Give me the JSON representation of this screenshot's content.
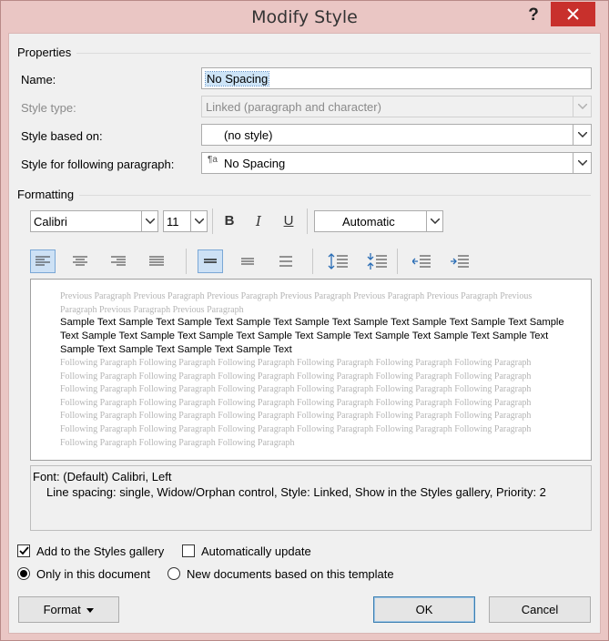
{
  "window": {
    "title": "Modify Style",
    "help_glyph": "?"
  },
  "properties": {
    "section_label": "Properties",
    "name_label": "Name:",
    "name_value": "No Spacing",
    "style_type_label": "Style type:",
    "style_type_value": "Linked (paragraph and character)",
    "based_on_label": "Style based on:",
    "based_on_value": "(no style)",
    "following_label": "Style for following paragraph:",
    "following_value": "No Spacing",
    "following_icon": "paragraph-style-icon"
  },
  "formatting": {
    "section_label": "Formatting",
    "font": "Calibri",
    "size": "11",
    "bold_glyph": "B",
    "italic_glyph": "I",
    "underline_glyph": "U",
    "color": "Automatic"
  },
  "preview": {
    "previous": "Previous Paragraph Previous Paragraph Previous Paragraph Previous Paragraph Previous Paragraph Previous Paragraph Previous Paragraph Previous Paragraph Previous Paragraph",
    "sample": "Sample Text Sample Text Sample Text Sample Text Sample Text Sample Text Sample Text Sample Text Sample Text Sample Text Sample Text Sample Text Sample Text Sample Text Sample Text Sample Text Sample Text Sample Text Sample Text Sample Text Sample Text",
    "following": "Following Paragraph Following Paragraph Following Paragraph Following Paragraph Following Paragraph Following Paragraph Following Paragraph Following Paragraph Following Paragraph Following Paragraph Following Paragraph Following Paragraph Following Paragraph Following Paragraph Following Paragraph Following Paragraph Following Paragraph Following Paragraph Following Paragraph Following Paragraph Following Paragraph Following Paragraph Following Paragraph Following Paragraph Following Paragraph Following Paragraph Following Paragraph Following Paragraph Following Paragraph Following Paragraph Following Paragraph Following Paragraph Following Paragraph Following Paragraph Following Paragraph Following Paragraph Following Paragraph Following Paragraph Following Paragraph"
  },
  "description": {
    "line1": "Font: (Default) Calibri, Left",
    "line2": "Line spacing:  single, Widow/Orphan control, Style: Linked, Show in the Styles gallery, Priority: 2"
  },
  "options": {
    "add_to_gallery": {
      "label": "Add to the Styles gallery",
      "checked": true
    },
    "auto_update": {
      "label": "Automatically update",
      "checked": false
    },
    "only_this_doc": {
      "label": "Only in this document",
      "selected": true
    },
    "new_docs": {
      "label": "New documents based on this template",
      "selected": false
    }
  },
  "buttons": {
    "format": "Format",
    "ok": "OK",
    "cancel": "Cancel"
  },
  "colors": {
    "accent_close": "#c8302c",
    "selection": "#cde4f7",
    "window_frame": "#eac6c4"
  }
}
